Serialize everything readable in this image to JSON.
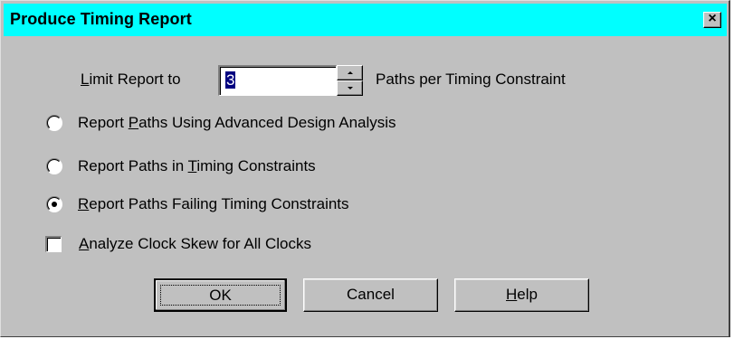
{
  "window": {
    "title": "Produce Timing Report",
    "close_glyph": "×",
    "title_bar_color": "#00ffff",
    "dialog_bg": "#c0c0c0"
  },
  "limit": {
    "label_mnemonic": "L",
    "label_rest": "imit Report to",
    "value": "3",
    "suffix": "Paths per Timing Constraint"
  },
  "options": [
    {
      "pre": "Report ",
      "mnemonic": "P",
      "post": "aths Using Advanced Design Analysis",
      "selected": false
    },
    {
      "pre": "Report Paths in ",
      "mnemonic": "T",
      "post": "iming Constraints",
      "selected": false
    },
    {
      "pre": "",
      "mnemonic": "R",
      "post": "eport Paths Failing Timing Constraints",
      "selected": true
    }
  ],
  "checkbox": {
    "mnemonic": "A",
    "rest": "nalyze Clock Skew for All Clocks",
    "checked": false
  },
  "buttons": {
    "ok": "OK",
    "cancel": "Cancel",
    "help_mnemonic": "H",
    "help_rest": "elp"
  },
  "icons": {
    "close": "close-icon",
    "spin_up": "arrow-up-icon",
    "spin_down": "arrow-down-icon"
  }
}
